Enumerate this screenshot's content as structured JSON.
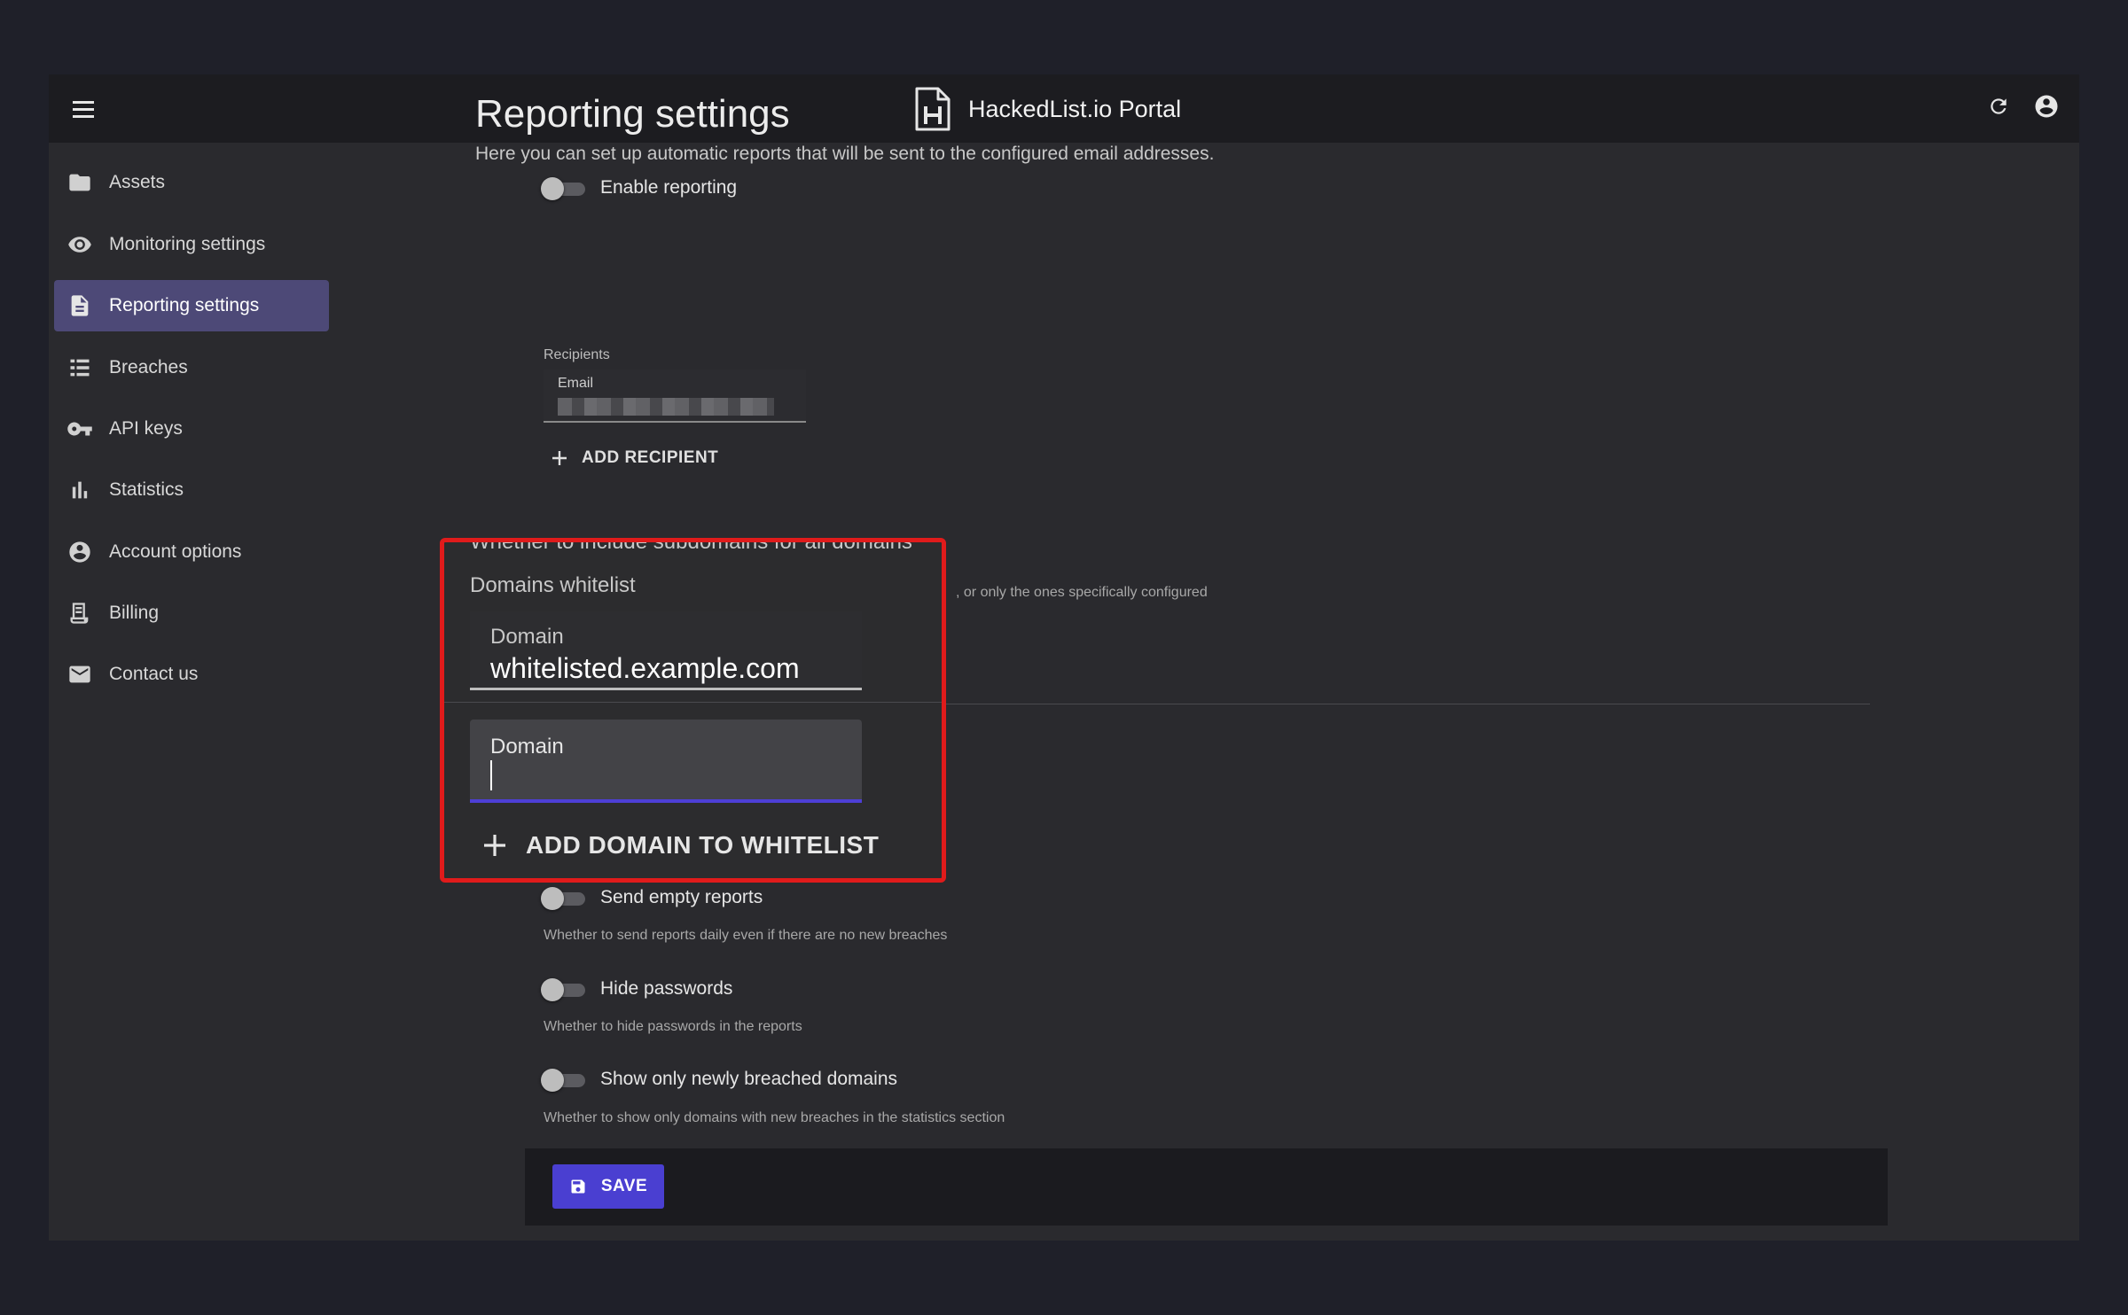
{
  "app": {
    "title": "HackedList.io Portal",
    "logo_icon": "hackedlist-logo-icon",
    "accent_color": "#4a3fd1",
    "highlight_color": "#e01b1b"
  },
  "topbar": {
    "menu_icon": "hamburger-menu-icon",
    "refresh_icon": "refresh-icon",
    "account_icon": "account-circle-icon"
  },
  "sidebar": {
    "items": [
      {
        "label": "Assets",
        "icon": "folder-icon",
        "active": false
      },
      {
        "label": "Monitoring settings",
        "icon": "eye-icon",
        "active": false
      },
      {
        "label": "Reporting settings",
        "icon": "document-icon",
        "active": true
      },
      {
        "label": "Breaches",
        "icon": "list-icon",
        "active": false
      },
      {
        "label": "API keys",
        "icon": "key-icon",
        "active": false
      },
      {
        "label": "Statistics",
        "icon": "bar-chart-icon",
        "active": false
      },
      {
        "label": "Account options",
        "icon": "account-circle-icon",
        "active": false
      },
      {
        "label": "Billing",
        "icon": "receipt-icon",
        "active": false
      },
      {
        "label": "Contact us",
        "icon": "mail-icon",
        "active": false
      }
    ]
  },
  "page": {
    "title": "Reporting settings",
    "subtitle": "Here you can set up automatic reports that will be sent to the configured email addresses."
  },
  "enable_reporting": {
    "label": "Enable reporting",
    "on": false
  },
  "recipients": {
    "section_label": "Recipients",
    "email_label": "Email",
    "add_label": "ADD RECIPIENT"
  },
  "include_subdomains": {
    "obscured_label": "Whether to include subdomains for all domains",
    "helper_tail": ", or only the ones specifically configured"
  },
  "send_empty_reports": {
    "label": "Send empty reports",
    "helper": "Whether to send reports daily even if there are no new breaches",
    "on": false
  },
  "hide_passwords": {
    "label": "Hide passwords",
    "helper": "Whether to hide passwords in the reports",
    "on": false
  },
  "show_newly_breached": {
    "label": "Show only newly breached domains",
    "helper": "Whether to show only domains with new breaches in the statistics section",
    "on": false
  },
  "save": {
    "label": "SAVE",
    "icon": "floppy-disk-icon"
  },
  "callout": {
    "section_title": "Domains whitelist",
    "domain_label": "Domain",
    "domain_value": "whitelisted.example.com",
    "new_domain_label": "Domain",
    "new_domain_value": "",
    "add_label": "ADD DOMAIN TO WHITELIST"
  }
}
